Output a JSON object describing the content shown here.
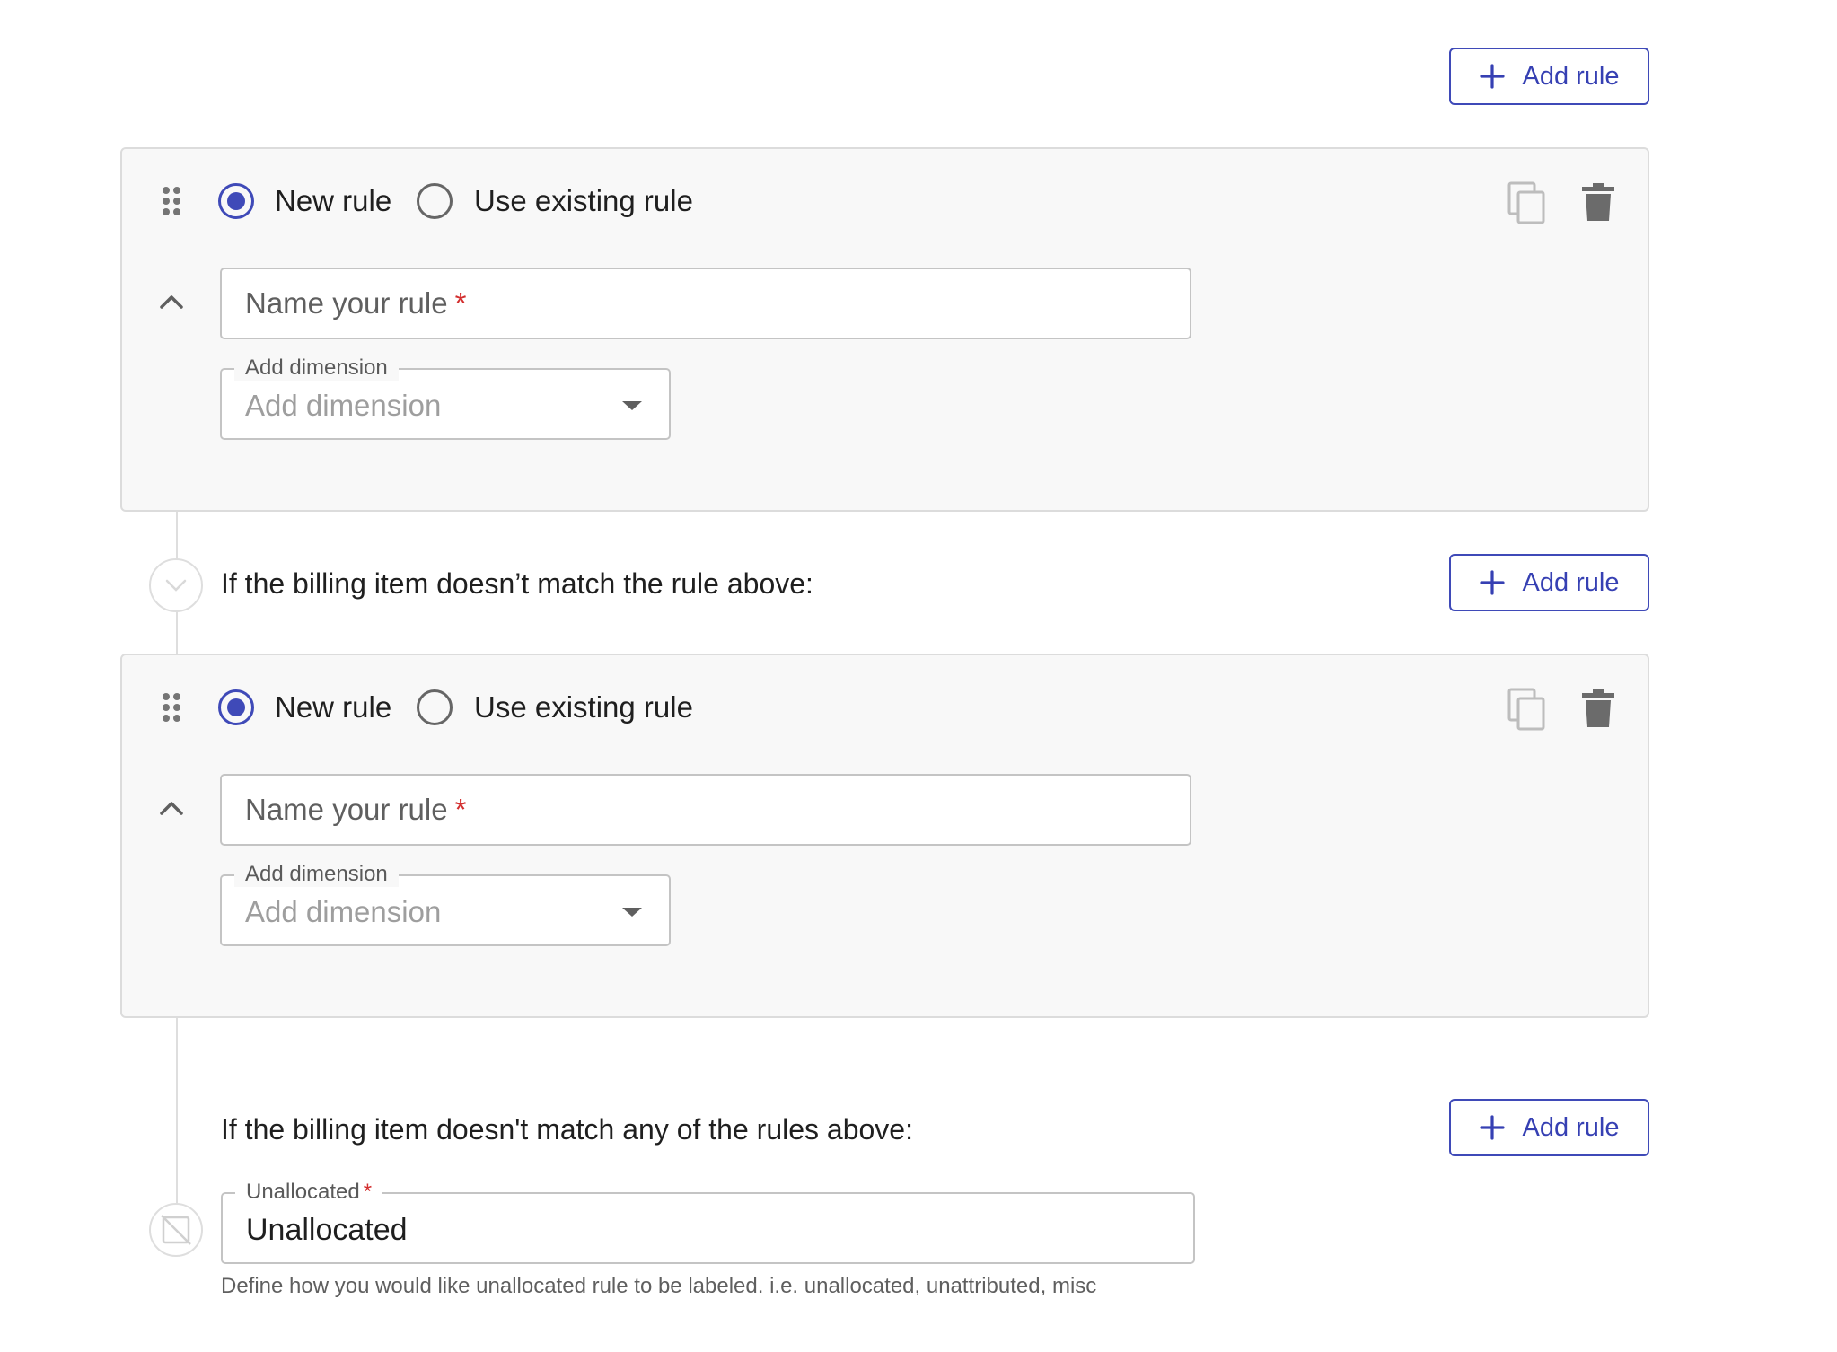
{
  "header": {
    "add_rule_label": "Add rule"
  },
  "rule_cards": [
    {
      "mode_options": [
        "New rule",
        "Use existing rule"
      ],
      "selected_mode": "New rule",
      "name_placeholder": "Name your rule",
      "required_mark": "*",
      "dimension_label": "Add dimension",
      "dimension_placeholder": "Add dimension"
    },
    {
      "mode_options": [
        "New rule",
        "Use existing rule"
      ],
      "selected_mode": "New rule",
      "name_placeholder": "Name your rule",
      "required_mark": "*",
      "dimension_label": "Add dimension",
      "dimension_placeholder": "Add dimension"
    }
  ],
  "connector": {
    "text": "If the billing item doesn’t match the rule above:",
    "add_rule_label": "Add rule"
  },
  "fallback": {
    "text": "If the billing item doesn't match any of the rules above:",
    "add_rule_label": "Add rule",
    "field_label": "Unallocated",
    "required_mark": "*",
    "field_value": "Unallocated",
    "helper_text": "Define how you would like unallocated rule to be labeled. i.e. unallocated, unattributed, misc"
  },
  "colors": {
    "accent": "#3f4ab8",
    "required": "#d32f2f",
    "card_bg": "#f8f8f8"
  },
  "icons": [
    "plus-icon",
    "drag-handle-icon",
    "copy-icon",
    "trash-icon",
    "chevron-up-icon",
    "chevron-down-icon",
    "unallocated-icon"
  ]
}
